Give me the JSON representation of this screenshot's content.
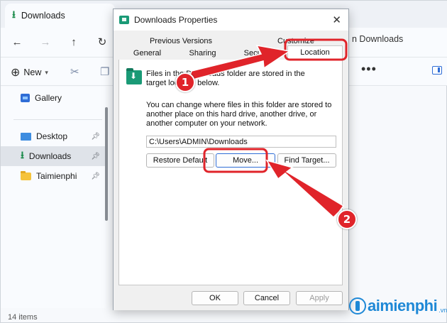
{
  "explorer": {
    "tab_title": "Downloads",
    "address_partial": "n Downloads",
    "new_label": "New",
    "more_icon": "more-dots-icon",
    "status": "14 items",
    "sidebar": [
      {
        "label": "Gallery",
        "icon": "gallery-icon",
        "pinned": false,
        "selected": false
      },
      {
        "label": "Desktop",
        "icon": "desktop-icon",
        "pinned": true,
        "selected": false
      },
      {
        "label": "Downloads",
        "icon": "download-icon",
        "pinned": true,
        "selected": true
      },
      {
        "label": "Taimienphi",
        "icon": "folder-icon",
        "pinned": true,
        "selected": false
      }
    ]
  },
  "dialog": {
    "title": "Downloads Properties",
    "tabs_row1": [
      "Previous Versions",
      "Customize"
    ],
    "tabs_row2": [
      "General",
      "Sharing",
      "Security",
      "Location"
    ],
    "active_tab": "Location",
    "info_text": "Files in the Downloads folder are stored in the target location below.",
    "description": "You can change where files in this folder are stored to another place on this hard drive, another drive, or another computer on your network.",
    "path_value": "C:\\Users\\ADMIN\\Downloads",
    "buttons": {
      "restore": "Restore Default",
      "move": "Move...",
      "find_target": "Find Target...",
      "ok": "OK",
      "cancel": "Cancel",
      "apply": "Apply"
    }
  },
  "annotations": {
    "step1": "1",
    "step2": "2",
    "color": "#e0242a"
  },
  "watermark": {
    "text": "aimienphi",
    "suffix": ".vn"
  }
}
